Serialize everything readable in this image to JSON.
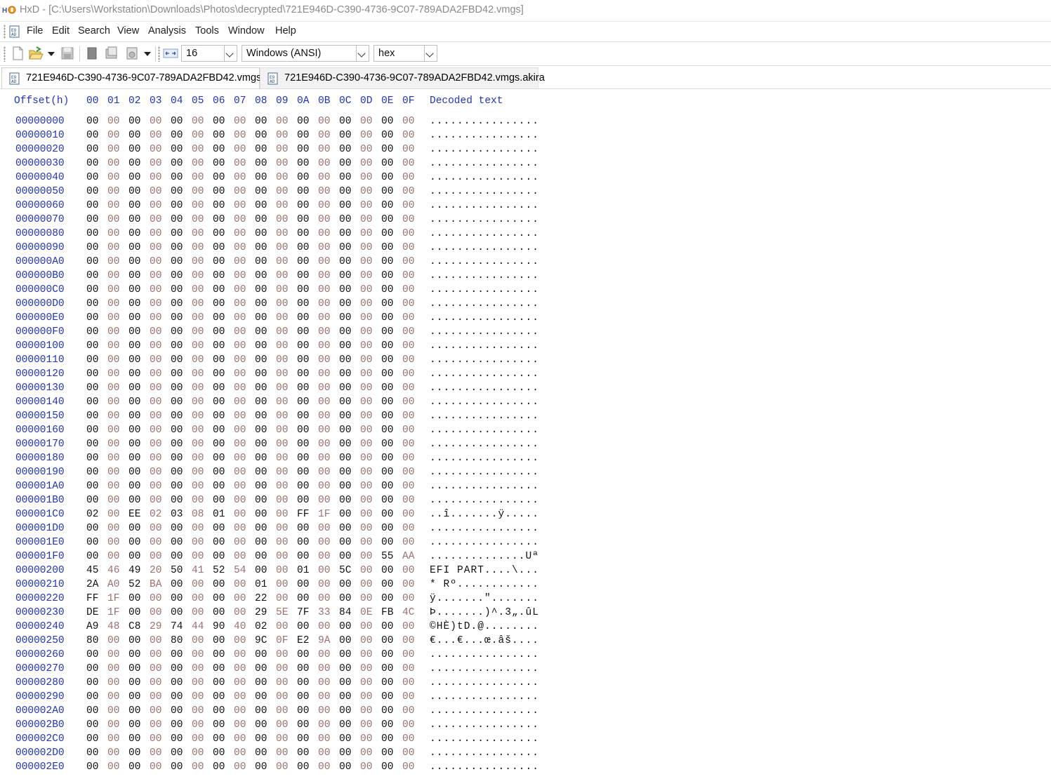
{
  "window": {
    "title": "HxD - [C:\\Users\\Workstation\\Downloads\\Photos\\decrypted\\721E946D-C390-4736-9C07-789ADA2FBD42.vmgs]"
  },
  "menu": [
    "File",
    "Edit",
    "Search",
    "View",
    "Analysis",
    "Tools",
    "Window",
    "Help"
  ],
  "toolbar": {
    "bytes_per_row": "16",
    "charset": "Windows (ANSI)",
    "offset_base": "hex"
  },
  "tabs": [
    {
      "label": "721E946D-C390-4736-9C07-789ADA2FBD42.vmgs",
      "active": true
    },
    {
      "label": "721E946D-C390-4736-9C07-789ADA2FBD42.vmgs.akira",
      "active": false
    }
  ],
  "hex": {
    "offset_header": "Offset(h)",
    "column_headers": [
      "00",
      "01",
      "02",
      "03",
      "04",
      "05",
      "06",
      "07",
      "08",
      "09",
      "0A",
      "0B",
      "0C",
      "0D",
      "0E",
      "0F"
    ],
    "decoded_header": "Decoded text",
    "rows": [
      {
        "offset": "00000000",
        "bytes": "00 00 00 00 00 00 00 00 00 00 00 00 00 00 00 00",
        "text": "................"
      },
      {
        "offset": "00000010",
        "bytes": "00 00 00 00 00 00 00 00 00 00 00 00 00 00 00 00",
        "text": "................"
      },
      {
        "offset": "00000020",
        "bytes": "00 00 00 00 00 00 00 00 00 00 00 00 00 00 00 00",
        "text": "................"
      },
      {
        "offset": "00000030",
        "bytes": "00 00 00 00 00 00 00 00 00 00 00 00 00 00 00 00",
        "text": "................"
      },
      {
        "offset": "00000040",
        "bytes": "00 00 00 00 00 00 00 00 00 00 00 00 00 00 00 00",
        "text": "................"
      },
      {
        "offset": "00000050",
        "bytes": "00 00 00 00 00 00 00 00 00 00 00 00 00 00 00 00",
        "text": "................"
      },
      {
        "offset": "00000060",
        "bytes": "00 00 00 00 00 00 00 00 00 00 00 00 00 00 00 00",
        "text": "................"
      },
      {
        "offset": "00000070",
        "bytes": "00 00 00 00 00 00 00 00 00 00 00 00 00 00 00 00",
        "text": "................"
      },
      {
        "offset": "00000080",
        "bytes": "00 00 00 00 00 00 00 00 00 00 00 00 00 00 00 00",
        "text": "................"
      },
      {
        "offset": "00000090",
        "bytes": "00 00 00 00 00 00 00 00 00 00 00 00 00 00 00 00",
        "text": "................"
      },
      {
        "offset": "000000A0",
        "bytes": "00 00 00 00 00 00 00 00 00 00 00 00 00 00 00 00",
        "text": "................"
      },
      {
        "offset": "000000B0",
        "bytes": "00 00 00 00 00 00 00 00 00 00 00 00 00 00 00 00",
        "text": "................"
      },
      {
        "offset": "000000C0",
        "bytes": "00 00 00 00 00 00 00 00 00 00 00 00 00 00 00 00",
        "text": "................"
      },
      {
        "offset": "000000D0",
        "bytes": "00 00 00 00 00 00 00 00 00 00 00 00 00 00 00 00",
        "text": "................"
      },
      {
        "offset": "000000E0",
        "bytes": "00 00 00 00 00 00 00 00 00 00 00 00 00 00 00 00",
        "text": "................"
      },
      {
        "offset": "000000F0",
        "bytes": "00 00 00 00 00 00 00 00 00 00 00 00 00 00 00 00",
        "text": "................"
      },
      {
        "offset": "00000100",
        "bytes": "00 00 00 00 00 00 00 00 00 00 00 00 00 00 00 00",
        "text": "................"
      },
      {
        "offset": "00000110",
        "bytes": "00 00 00 00 00 00 00 00 00 00 00 00 00 00 00 00",
        "text": "................"
      },
      {
        "offset": "00000120",
        "bytes": "00 00 00 00 00 00 00 00 00 00 00 00 00 00 00 00",
        "text": "................"
      },
      {
        "offset": "00000130",
        "bytes": "00 00 00 00 00 00 00 00 00 00 00 00 00 00 00 00",
        "text": "................"
      },
      {
        "offset": "00000140",
        "bytes": "00 00 00 00 00 00 00 00 00 00 00 00 00 00 00 00",
        "text": "................"
      },
      {
        "offset": "00000150",
        "bytes": "00 00 00 00 00 00 00 00 00 00 00 00 00 00 00 00",
        "text": "................"
      },
      {
        "offset": "00000160",
        "bytes": "00 00 00 00 00 00 00 00 00 00 00 00 00 00 00 00",
        "text": "................"
      },
      {
        "offset": "00000170",
        "bytes": "00 00 00 00 00 00 00 00 00 00 00 00 00 00 00 00",
        "text": "................"
      },
      {
        "offset": "00000180",
        "bytes": "00 00 00 00 00 00 00 00 00 00 00 00 00 00 00 00",
        "text": "................"
      },
      {
        "offset": "00000190",
        "bytes": "00 00 00 00 00 00 00 00 00 00 00 00 00 00 00 00",
        "text": "................"
      },
      {
        "offset": "000001A0",
        "bytes": "00 00 00 00 00 00 00 00 00 00 00 00 00 00 00 00",
        "text": "................"
      },
      {
        "offset": "000001B0",
        "bytes": "00 00 00 00 00 00 00 00 00 00 00 00 00 00 00 00",
        "text": "................"
      },
      {
        "offset": "000001C0",
        "bytes": "02 00 EE 02 03 08 01 00 00 00 FF 1F 00 00 00 00",
        "text": "..î.......ÿ....."
      },
      {
        "offset": "000001D0",
        "bytes": "00 00 00 00 00 00 00 00 00 00 00 00 00 00 00 00",
        "text": "................"
      },
      {
        "offset": "000001E0",
        "bytes": "00 00 00 00 00 00 00 00 00 00 00 00 00 00 00 00",
        "text": "................"
      },
      {
        "offset": "000001F0",
        "bytes": "00 00 00 00 00 00 00 00 00 00 00 00 00 00 55 AA",
        "text": "..............Uª"
      },
      {
        "offset": "00000200",
        "bytes": "45 46 49 20 50 41 52 54 00 00 01 00 5C 00 00 00",
        "text": "EFI PART....\\..."
      },
      {
        "offset": "00000210",
        "bytes": "2A A0 52 BA 00 00 00 00 01 00 00 00 00 00 00 00",
        "text": "* Rº............"
      },
      {
        "offset": "00000220",
        "bytes": "FF 1F 00 00 00 00 00 00 22 00 00 00 00 00 00 00",
        "text": "ÿ.......\"......."
      },
      {
        "offset": "00000230",
        "bytes": "DE 1F 00 00 00 00 00 00 29 5E 7F 33 84 0E FB 4C",
        "text": "Þ.......)^.3„.ûL"
      },
      {
        "offset": "00000240",
        "bytes": "A9 48 C8 29 74 44 90 40 02 00 00 00 00 00 00 00",
        "text": "©HÈ)tD.@........"
      },
      {
        "offset": "00000250",
        "bytes": "80 00 00 00 80 00 00 00 9C 0F E2 9A 00 00 00 00",
        "text": "€...€...œ.âš...."
      },
      {
        "offset": "00000260",
        "bytes": "00 00 00 00 00 00 00 00 00 00 00 00 00 00 00 00",
        "text": "................"
      },
      {
        "offset": "00000270",
        "bytes": "00 00 00 00 00 00 00 00 00 00 00 00 00 00 00 00",
        "text": "................"
      },
      {
        "offset": "00000280",
        "bytes": "00 00 00 00 00 00 00 00 00 00 00 00 00 00 00 00",
        "text": "................"
      },
      {
        "offset": "00000290",
        "bytes": "00 00 00 00 00 00 00 00 00 00 00 00 00 00 00 00",
        "text": "................"
      },
      {
        "offset": "000002A0",
        "bytes": "00 00 00 00 00 00 00 00 00 00 00 00 00 00 00 00",
        "text": "................"
      },
      {
        "offset": "000002B0",
        "bytes": "00 00 00 00 00 00 00 00 00 00 00 00 00 00 00 00",
        "text": "................"
      },
      {
        "offset": "000002C0",
        "bytes": "00 00 00 00 00 00 00 00 00 00 00 00 00 00 00 00",
        "text": "................"
      },
      {
        "offset": "000002D0",
        "bytes": "00 00 00 00 00 00 00 00 00 00 00 00 00 00 00 00",
        "text": "................"
      },
      {
        "offset": "000002E0",
        "bytes": "00 00 00 00 00 00 00 00 00 00 00 00 00 00 00 00",
        "text": "................"
      }
    ]
  },
  "colors": {
    "offset_blue": "#2233bb",
    "even_byte": "#111111",
    "odd_byte": "#9a7070"
  }
}
